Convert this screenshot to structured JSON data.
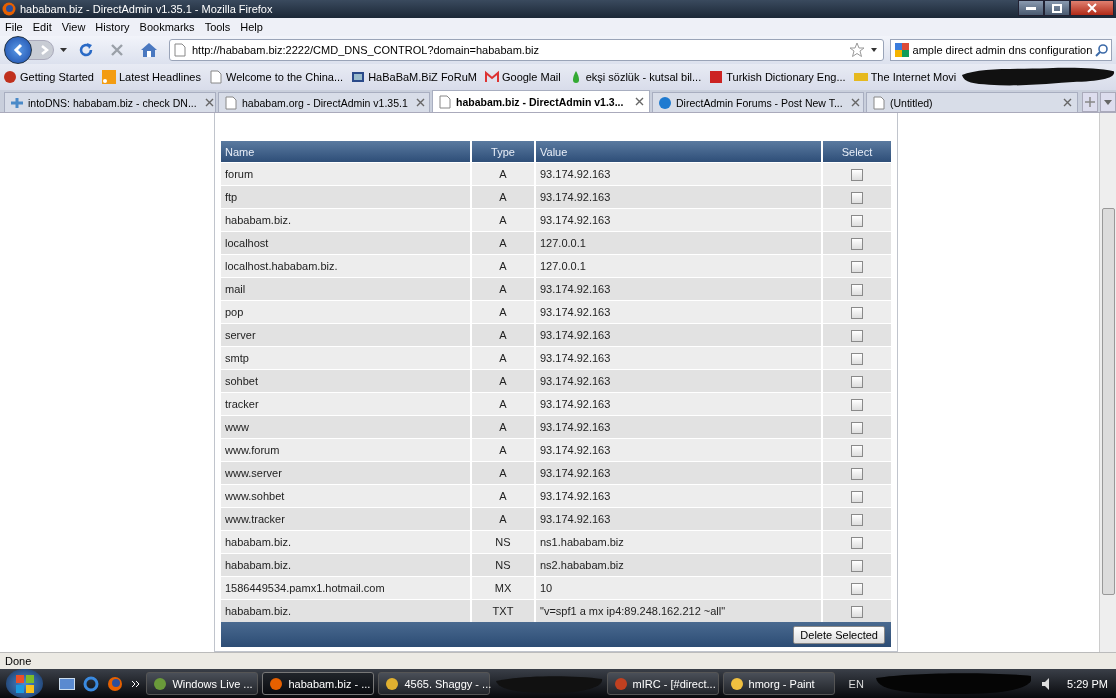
{
  "window": {
    "title": "hababam.biz - DirectAdmin v1.35.1 - Mozilla Firefox"
  },
  "menu": [
    "File",
    "Edit",
    "View",
    "History",
    "Bookmarks",
    "Tools",
    "Help"
  ],
  "address": {
    "value": "http://hababam.biz:2222/CMD_DNS_CONTROL?domain=hababam.biz"
  },
  "search": {
    "value": "ample direct admin dns configuration"
  },
  "bookmarks": [
    {
      "label": "Getting Started",
      "kind": "firefox"
    },
    {
      "label": "Latest Headlines",
      "kind": "rss"
    },
    {
      "label": "Welcome to the China...",
      "kind": "page"
    },
    {
      "label": "HaBaBaM.BiZ FoRuM",
      "kind": "film"
    },
    {
      "label": "Google Mail",
      "kind": "mail"
    },
    {
      "label": "ekşi sözlük - kutsal bil...",
      "kind": "drop"
    },
    {
      "label": "Turkish Dictionary Eng...",
      "kind": "s"
    },
    {
      "label": "The Internet Movi",
      "kind": "imdb"
    }
  ],
  "tabs": [
    {
      "label": "intoDNS: hababam.biz - check DN...",
      "selected": false,
      "kind": "plug"
    },
    {
      "label": "hababam.org - DirectAdmin v1.35.1",
      "selected": false,
      "kind": "page"
    },
    {
      "label": "hababam.biz - DirectAdmin v1.3...",
      "selected": true,
      "kind": "page"
    },
    {
      "label": "DirectAdmin Forums - Post New T...",
      "selected": false,
      "kind": "globe"
    },
    {
      "label": "(Untitled)",
      "selected": false,
      "kind": "page"
    }
  ],
  "table": {
    "columns": [
      "Name",
      "Type",
      "Value",
      "Select"
    ],
    "rows": [
      {
        "name": "forum",
        "type": "A",
        "value": "93.174.92.163",
        "checked": false
      },
      {
        "name": "ftp",
        "type": "A",
        "value": "93.174.92.163",
        "checked": false
      },
      {
        "name": "hababam.biz.",
        "type": "A",
        "value": "93.174.92.163",
        "checked": false
      },
      {
        "name": "localhost",
        "type": "A",
        "value": "127.0.0.1",
        "checked": false
      },
      {
        "name": "localhost.hababam.biz.",
        "type": "A",
        "value": "127.0.0.1",
        "checked": false
      },
      {
        "name": "mail",
        "type": "A",
        "value": "93.174.92.163",
        "checked": false
      },
      {
        "name": "pop",
        "type": "A",
        "value": "93.174.92.163",
        "checked": false
      },
      {
        "name": "server",
        "type": "A",
        "value": "93.174.92.163",
        "checked": false
      },
      {
        "name": "smtp",
        "type": "A",
        "value": "93.174.92.163",
        "checked": false
      },
      {
        "name": "sohbet",
        "type": "A",
        "value": "93.174.92.163",
        "checked": false
      },
      {
        "name": "tracker",
        "type": "A",
        "value": "93.174.92.163",
        "checked": false
      },
      {
        "name": "www",
        "type": "A",
        "value": "93.174.92.163",
        "checked": false
      },
      {
        "name": "www.forum",
        "type": "A",
        "value": "93.174.92.163",
        "checked": false
      },
      {
        "name": "www.server",
        "type": "A",
        "value": "93.174.92.163",
        "checked": false
      },
      {
        "name": "www.sohbet",
        "type": "A",
        "value": "93.174.92.163",
        "checked": false
      },
      {
        "name": "www.tracker",
        "type": "A",
        "value": "93.174.92.163",
        "checked": false
      },
      {
        "name": "hababam.biz.",
        "type": "NS",
        "value": "ns1.hababam.biz",
        "checked": false
      },
      {
        "name": "hababam.biz.",
        "type": "NS",
        "value": "ns2.hababam.biz",
        "checked": false
      },
      {
        "name": "1586449534.pamx1.hotmail.com",
        "type": "MX",
        "value": "10",
        "checked": false
      },
      {
        "name": "hababam.biz.",
        "type": "TXT",
        "value": "\"v=spf1 a mx ip4:89.248.162.212 ~all\"",
        "checked": false
      }
    ],
    "delete_button": "Delete Selected"
  },
  "status_bar": "Done",
  "taskbar": {
    "items": [
      {
        "label": "Windows Live ...",
        "selected": false
      },
      {
        "label": "hababam.biz - ...",
        "selected": true
      },
      {
        "label": "4565. Shaggy - ...",
        "selected": false
      },
      {
        "label": "mIRC - [#direct...",
        "selected": false
      },
      {
        "label": "hmorg - Paint",
        "selected": false
      }
    ],
    "language": "EN",
    "clock": "5:29 PM"
  }
}
